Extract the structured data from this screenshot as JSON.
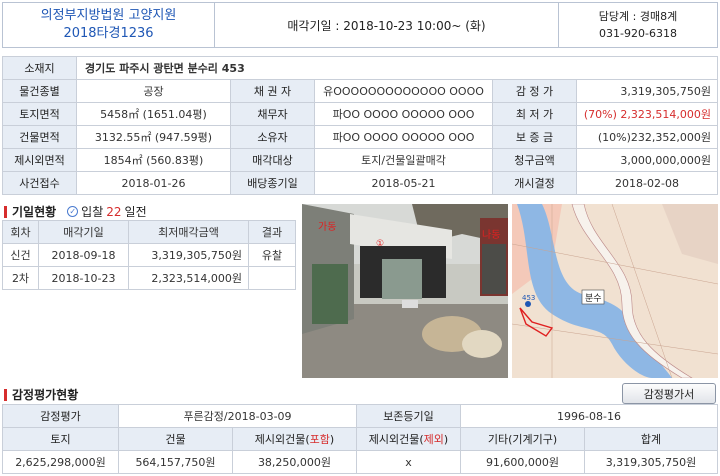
{
  "header": {
    "court": "의정부지방법원 고양지원",
    "case_no": "2018타경1236",
    "sale_date": "매각기일 : 2018-10-23   10:00~ (화)",
    "team": "담당계 : 경매8계",
    "phone": "031-920-6318"
  },
  "info": {
    "address_label": "소재지",
    "address": "경기도 파주시 광탄면 분수리 453",
    "rows": [
      [
        "물건종별",
        "공장",
        "채 권 자",
        "유OOOOOOOOOOOOO OOOO",
        "감 정 가",
        "3,319,305,750원"
      ],
      [
        "토지면적",
        "5458㎡ (1651.04평)",
        "채무자",
        "파OO OOOO OOOOO OOO",
        "최 저 가",
        "(70%) 2,323,514,000원"
      ],
      [
        "건물면적",
        "3132.55㎡ (947.59평)",
        "소유자",
        "파OO OOOO OOOOO OOO",
        "보 증 금",
        "(10%)232,352,000원"
      ],
      [
        "제시외면적",
        "1854㎡ (560.83평)",
        "매각대상",
        "토지/건물일괄매각",
        "청구금액",
        "3,000,000,000원"
      ],
      [
        "사건접수",
        "2018-01-26",
        "배당종기일",
        "2018-05-21",
        "개시결정",
        "2018-02-08"
      ]
    ]
  },
  "history": {
    "title": "기일현황",
    "ipchal_pre": "입찰",
    "ipchal_num": "22",
    "ipchal_post": "일전",
    "headers": [
      "회차",
      "매각기일",
      "최저매각금액",
      "결과"
    ],
    "rows": [
      [
        "신건",
        "2018-09-18",
        "3,319,305,750원",
        "유찰"
      ],
      [
        "2차",
        "2018-10-23",
        "2,323,514,000원",
        ""
      ]
    ]
  },
  "photo": {
    "label_a": "가동",
    "label_b": "나동",
    "label_c": "①"
  },
  "map": {
    "place": "분수",
    "label": "453"
  },
  "appraisal": {
    "title": "감정평가현황",
    "button": "감정평가서",
    "row1": [
      "감정평가",
      "푸른감정/2018-03-09",
      "보존등기일",
      "1996-08-16"
    ],
    "headers": [
      "토지",
      "건물",
      "제시외건물(포함)",
      "제시외건물(제외)",
      "기타(기계기구)",
      "합계"
    ],
    "h3_pre": "제시외건물(",
    "h3_red": "포함",
    "h3_post": ")",
    "h4_pre": "제시외건물(",
    "h4_red": "제외",
    "h4_post": ")",
    "values": [
      "2,625,298,000원",
      "564,157,750원",
      "38,250,000원",
      "x",
      "91,600,000원",
      "3,319,305,750원"
    ]
  },
  "colors": {
    "accent": "#1f57b5",
    "highlight": "#d62d2d",
    "label_bg": "#e7edf5"
  }
}
